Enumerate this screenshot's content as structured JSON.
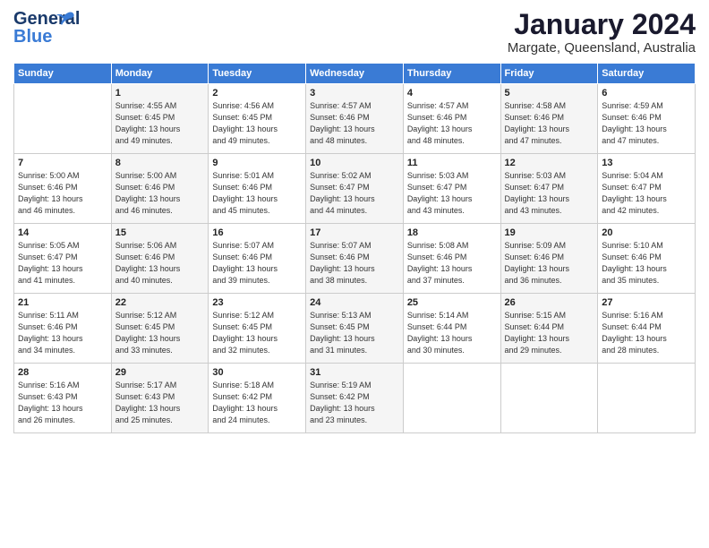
{
  "header": {
    "logo_general": "General",
    "logo_blue": "Blue",
    "month": "January 2024",
    "location": "Margate, Queensland, Australia"
  },
  "days_of_week": [
    "Sunday",
    "Monday",
    "Tuesday",
    "Wednesday",
    "Thursday",
    "Friday",
    "Saturday"
  ],
  "weeks": [
    [
      {
        "day": "",
        "info": ""
      },
      {
        "day": "1",
        "info": "Sunrise: 4:55 AM\nSunset: 6:45 PM\nDaylight: 13 hours\nand 49 minutes."
      },
      {
        "day": "2",
        "info": "Sunrise: 4:56 AM\nSunset: 6:45 PM\nDaylight: 13 hours\nand 49 minutes."
      },
      {
        "day": "3",
        "info": "Sunrise: 4:57 AM\nSunset: 6:46 PM\nDaylight: 13 hours\nand 48 minutes."
      },
      {
        "day": "4",
        "info": "Sunrise: 4:57 AM\nSunset: 6:46 PM\nDaylight: 13 hours\nand 48 minutes."
      },
      {
        "day": "5",
        "info": "Sunrise: 4:58 AM\nSunset: 6:46 PM\nDaylight: 13 hours\nand 47 minutes."
      },
      {
        "day": "6",
        "info": "Sunrise: 4:59 AM\nSunset: 6:46 PM\nDaylight: 13 hours\nand 47 minutes."
      }
    ],
    [
      {
        "day": "7",
        "info": "Sunrise: 5:00 AM\nSunset: 6:46 PM\nDaylight: 13 hours\nand 46 minutes."
      },
      {
        "day": "8",
        "info": "Sunrise: 5:00 AM\nSunset: 6:46 PM\nDaylight: 13 hours\nand 46 minutes."
      },
      {
        "day": "9",
        "info": "Sunrise: 5:01 AM\nSunset: 6:46 PM\nDaylight: 13 hours\nand 45 minutes."
      },
      {
        "day": "10",
        "info": "Sunrise: 5:02 AM\nSunset: 6:47 PM\nDaylight: 13 hours\nand 44 minutes."
      },
      {
        "day": "11",
        "info": "Sunrise: 5:03 AM\nSunset: 6:47 PM\nDaylight: 13 hours\nand 43 minutes."
      },
      {
        "day": "12",
        "info": "Sunrise: 5:03 AM\nSunset: 6:47 PM\nDaylight: 13 hours\nand 43 minutes."
      },
      {
        "day": "13",
        "info": "Sunrise: 5:04 AM\nSunset: 6:47 PM\nDaylight: 13 hours\nand 42 minutes."
      }
    ],
    [
      {
        "day": "14",
        "info": "Sunrise: 5:05 AM\nSunset: 6:47 PM\nDaylight: 13 hours\nand 41 minutes."
      },
      {
        "day": "15",
        "info": "Sunrise: 5:06 AM\nSunset: 6:46 PM\nDaylight: 13 hours\nand 40 minutes."
      },
      {
        "day": "16",
        "info": "Sunrise: 5:07 AM\nSunset: 6:46 PM\nDaylight: 13 hours\nand 39 minutes."
      },
      {
        "day": "17",
        "info": "Sunrise: 5:07 AM\nSunset: 6:46 PM\nDaylight: 13 hours\nand 38 minutes."
      },
      {
        "day": "18",
        "info": "Sunrise: 5:08 AM\nSunset: 6:46 PM\nDaylight: 13 hours\nand 37 minutes."
      },
      {
        "day": "19",
        "info": "Sunrise: 5:09 AM\nSunset: 6:46 PM\nDaylight: 13 hours\nand 36 minutes."
      },
      {
        "day": "20",
        "info": "Sunrise: 5:10 AM\nSunset: 6:46 PM\nDaylight: 13 hours\nand 35 minutes."
      }
    ],
    [
      {
        "day": "21",
        "info": "Sunrise: 5:11 AM\nSunset: 6:46 PM\nDaylight: 13 hours\nand 34 minutes."
      },
      {
        "day": "22",
        "info": "Sunrise: 5:12 AM\nSunset: 6:45 PM\nDaylight: 13 hours\nand 33 minutes."
      },
      {
        "day": "23",
        "info": "Sunrise: 5:12 AM\nSunset: 6:45 PM\nDaylight: 13 hours\nand 32 minutes."
      },
      {
        "day": "24",
        "info": "Sunrise: 5:13 AM\nSunset: 6:45 PM\nDaylight: 13 hours\nand 31 minutes."
      },
      {
        "day": "25",
        "info": "Sunrise: 5:14 AM\nSunset: 6:44 PM\nDaylight: 13 hours\nand 30 minutes."
      },
      {
        "day": "26",
        "info": "Sunrise: 5:15 AM\nSunset: 6:44 PM\nDaylight: 13 hours\nand 29 minutes."
      },
      {
        "day": "27",
        "info": "Sunrise: 5:16 AM\nSunset: 6:44 PM\nDaylight: 13 hours\nand 28 minutes."
      }
    ],
    [
      {
        "day": "28",
        "info": "Sunrise: 5:16 AM\nSunset: 6:43 PM\nDaylight: 13 hours\nand 26 minutes."
      },
      {
        "day": "29",
        "info": "Sunrise: 5:17 AM\nSunset: 6:43 PM\nDaylight: 13 hours\nand 25 minutes."
      },
      {
        "day": "30",
        "info": "Sunrise: 5:18 AM\nSunset: 6:42 PM\nDaylight: 13 hours\nand 24 minutes."
      },
      {
        "day": "31",
        "info": "Sunrise: 5:19 AM\nSunset: 6:42 PM\nDaylight: 13 hours\nand 23 minutes."
      },
      {
        "day": "",
        "info": ""
      },
      {
        "day": "",
        "info": ""
      },
      {
        "day": "",
        "info": ""
      }
    ]
  ]
}
